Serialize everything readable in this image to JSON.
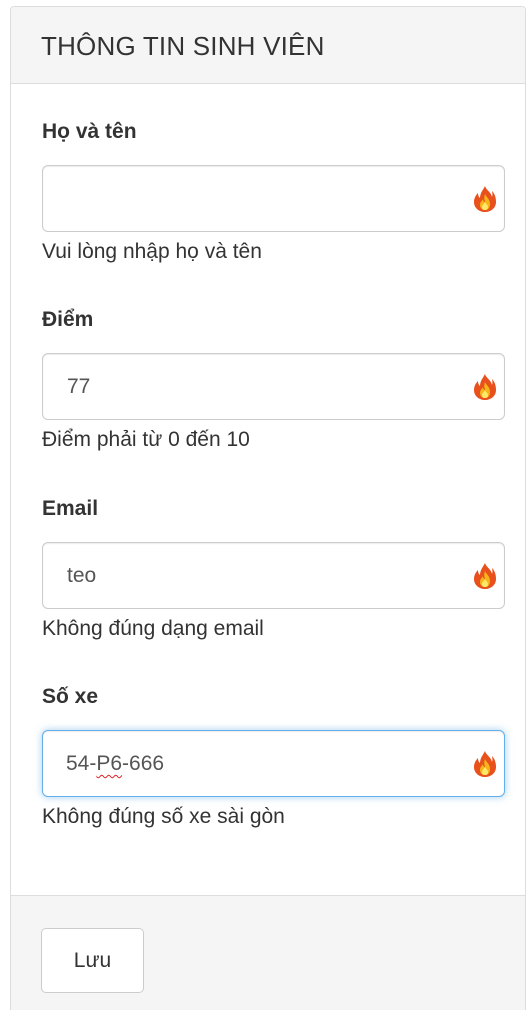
{
  "panel": {
    "title": "THÔNG TIN SINH VIÊN"
  },
  "fields": [
    {
      "label": "Họ và tên",
      "value": "",
      "help": "Vui lòng nhập họ và tên",
      "icon": "fire-icon"
    },
    {
      "label": "Điểm",
      "value": "77",
      "help": "Điểm phải từ 0 đến 10",
      "icon": "fire-icon"
    },
    {
      "label": "Email",
      "value": "teo",
      "help": "Không đúng dạng email",
      "icon": "fire-icon"
    },
    {
      "label": "Số xe",
      "value_prefix": "54-",
      "value_marked": "P6",
      "value_suffix": "-666",
      "help": "Không đúng số xe sài gòn",
      "icon": "fire-icon"
    }
  ],
  "footer": {
    "save_label": "Lưu"
  },
  "colors": {
    "focus_border": "#66afe9",
    "panel_bg": "#f5f5f5",
    "border": "#dddddd"
  }
}
